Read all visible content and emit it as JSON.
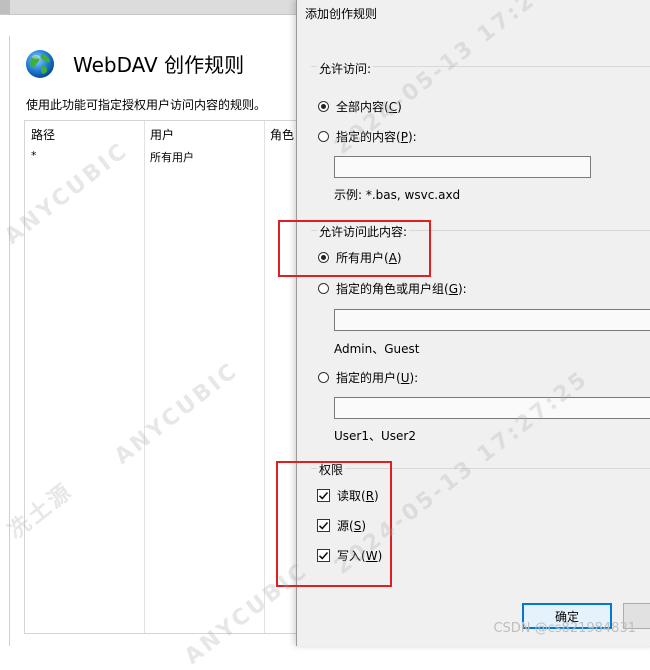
{
  "background_page": {
    "title": "WebDAV 创作规则",
    "description": "使用此功能可指定授权用户访问内容的规则。",
    "columns": [
      "路径",
      "用户",
      "角色"
    ],
    "rows": [
      {
        "path": "*",
        "users": "所有用户"
      }
    ]
  },
  "dialog": {
    "title": "添加创作规则",
    "allow_access_to": {
      "label": "允许访问:",
      "all_content_label": "全部内容(",
      "all_content_key": "C",
      "all_content_selected": true,
      "specified_content_label": "指定的内容(",
      "specified_content_key": "P",
      "specified_content_suffix": "):",
      "specified_content_value": "",
      "example": "示例: *.bas, wsvc.axd"
    },
    "allow_access_by": {
      "label": "允许访问此内容:",
      "all_users_label": "所有用户(",
      "all_users_key": "A",
      "all_users_selected": true,
      "roles_groups_label": "指定的角色或用户组(",
      "roles_groups_key": "G",
      "roles_groups_suffix": "):",
      "roles_groups_value": "",
      "roles_groups_example": "Admin、Guest",
      "users_label": "指定的用户(",
      "users_key": "U",
      "users_suffix": "):",
      "users_value": "",
      "users_example": "User1、User2"
    },
    "permissions": {
      "label": "权限",
      "read_label": "读取(",
      "read_key": "R",
      "read_checked": true,
      "source_label": "源(",
      "source_key": "S",
      "source_checked": true,
      "write_label": "写入(",
      "write_key": "W",
      "write_checked": true
    },
    "ok_button": "确定",
    "cancel_button": ""
  },
  "watermarks": {
    "brand": "ANYCUBIC",
    "author": "冼土源",
    "timestamp": "2024-05-13 17:27:25"
  },
  "site_credit": "CSDN @cs821984831",
  "colors": {
    "highlight_box": "#e02020",
    "primary_button_border": "#0078d7"
  }
}
